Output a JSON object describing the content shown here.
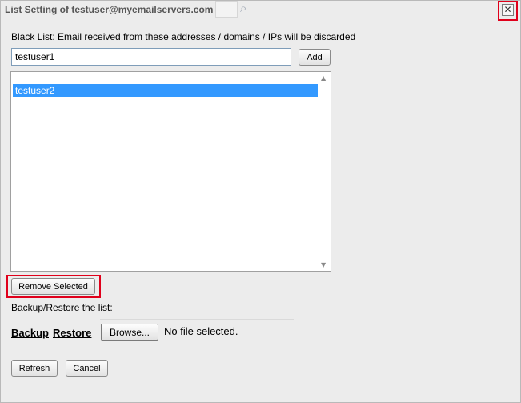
{
  "dialog": {
    "title": "List Setting of testuser@myemailservers.com",
    "close_glyph": "✕"
  },
  "blacklist": {
    "description": "Black List: Email received from these addresses / domains / IPs will be discarded",
    "input_value": "testuser1",
    "add_label": "Add",
    "items": [
      "testuser2"
    ],
    "selected_item": "testuser2",
    "remove_label": "Remove Selected"
  },
  "backup": {
    "label": "Backup/Restore the list:",
    "backup_link": "Backup",
    "restore_link": "Restore",
    "browse_label": "Browse...",
    "file_status": "No file selected."
  },
  "footer": {
    "refresh_label": "Refresh",
    "cancel_label": "Cancel"
  },
  "colors": {
    "selection": "#3399ff",
    "highlight_outline": "#e0001b"
  },
  "icons": {
    "close": "close-icon",
    "background_search": "search-icon"
  }
}
